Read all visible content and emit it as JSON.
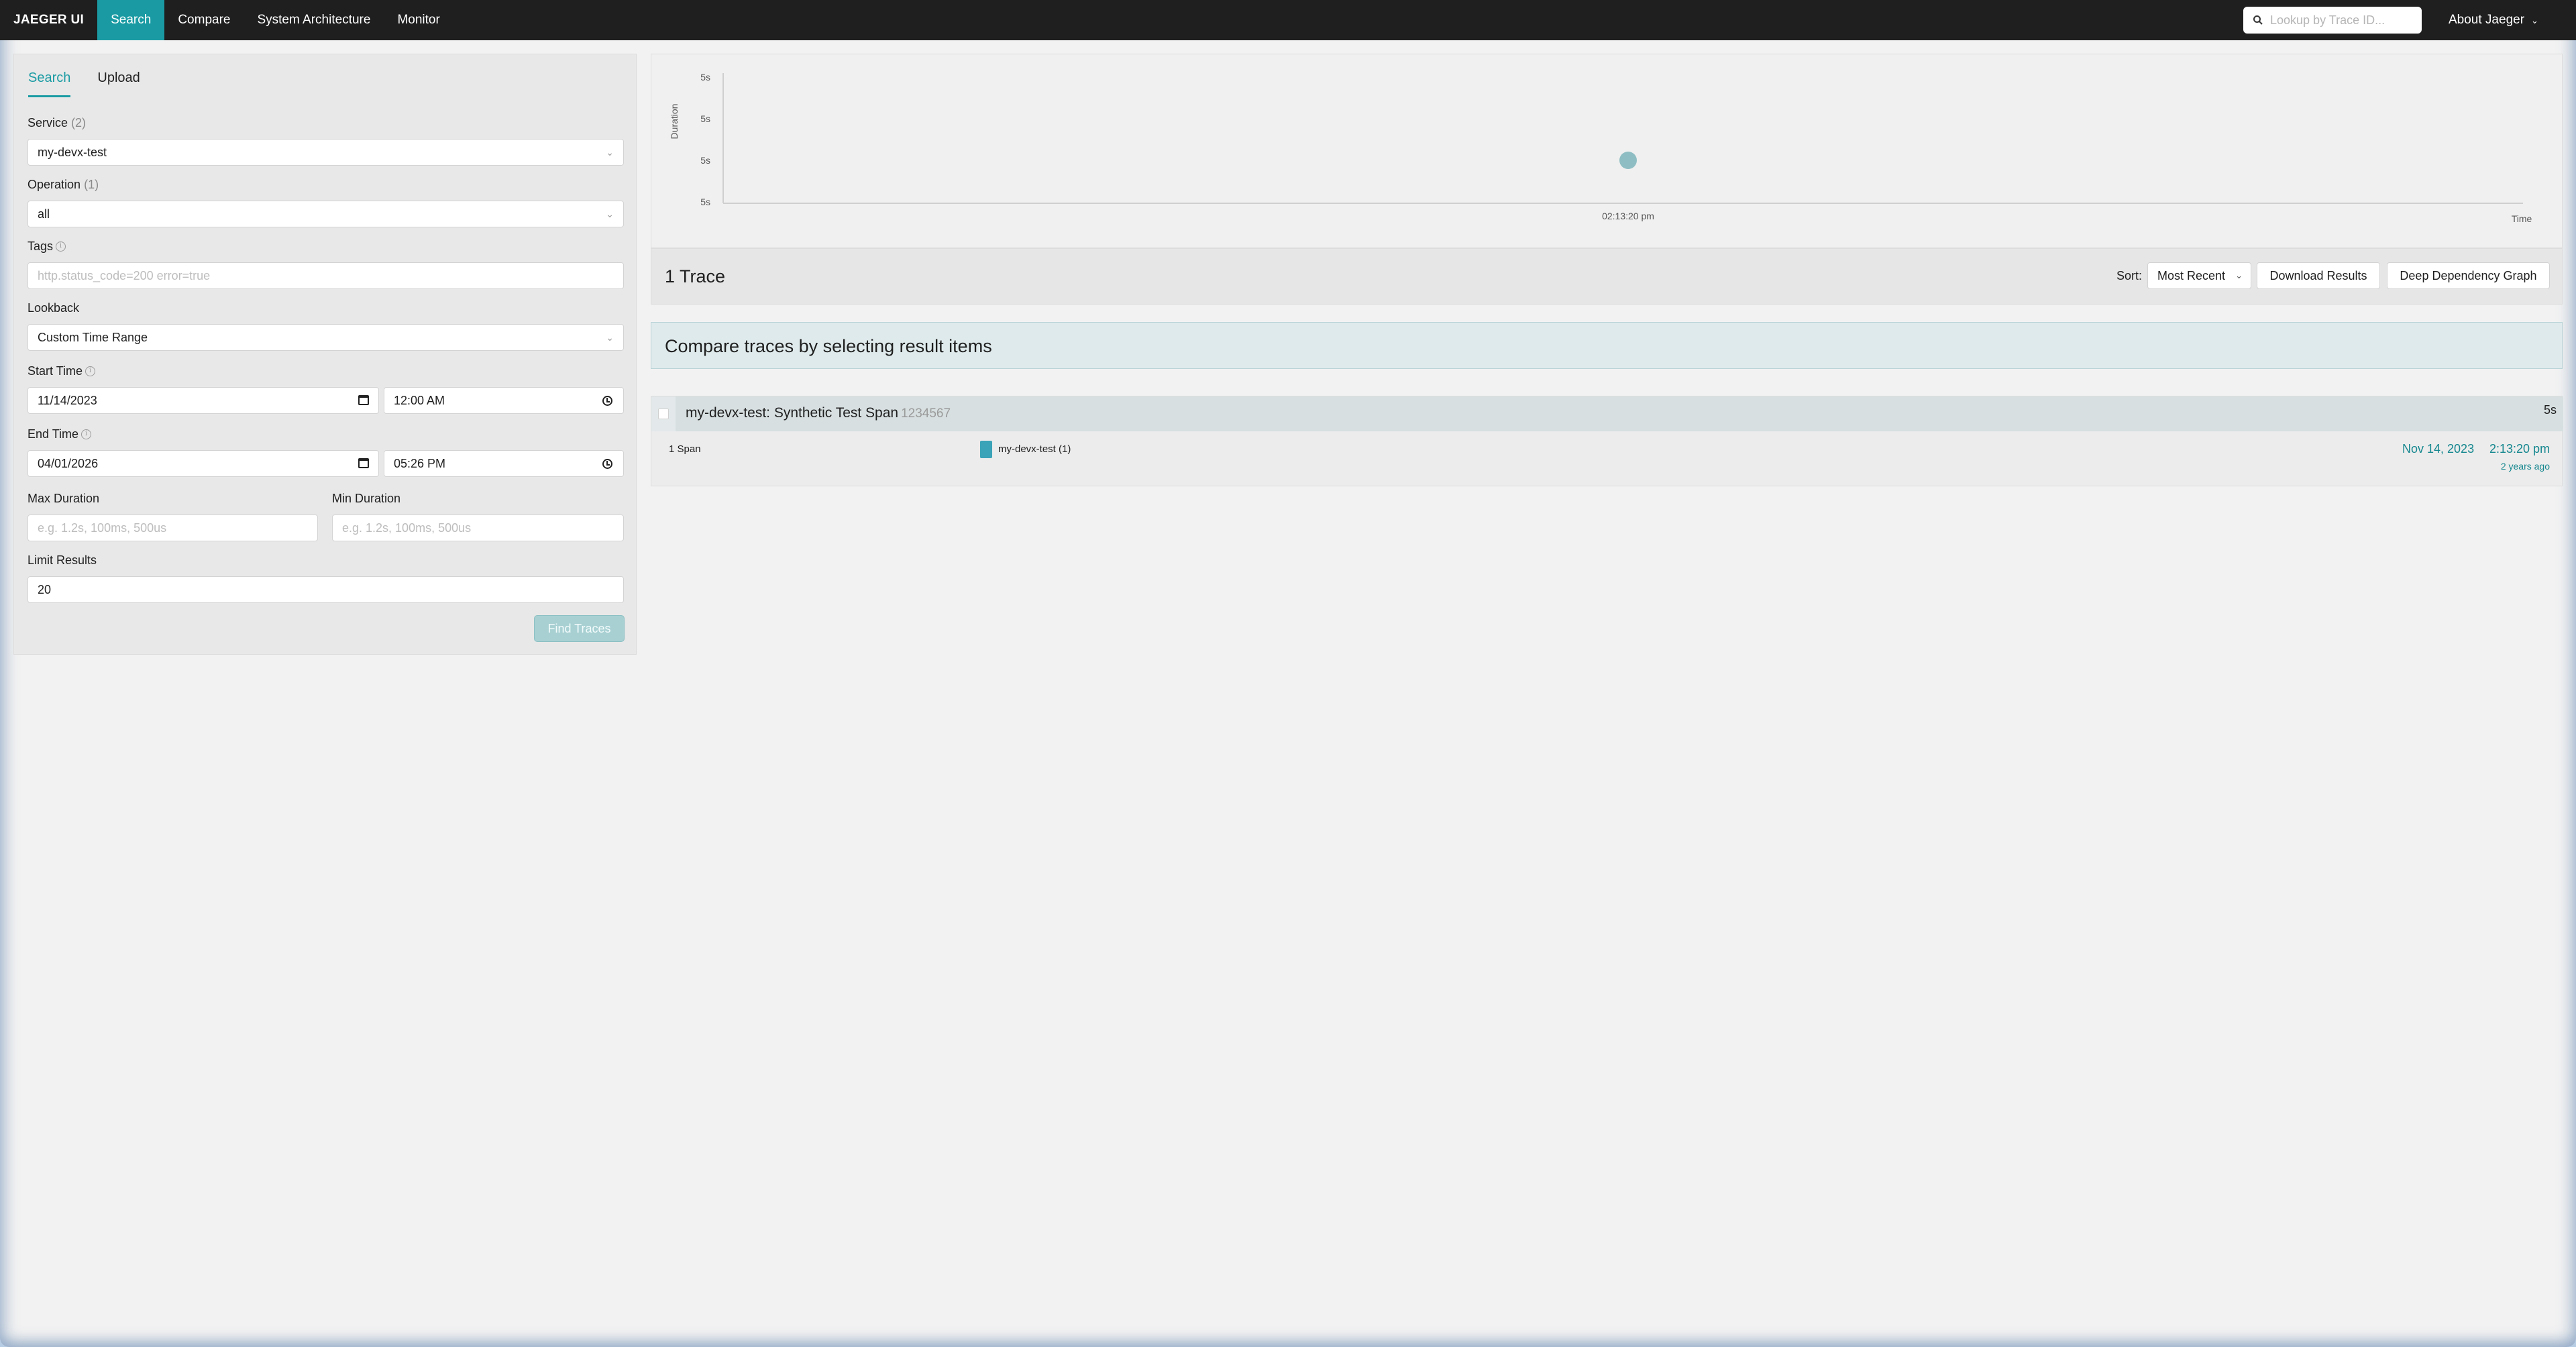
{
  "nav": {
    "brand": "JAEGER UI",
    "items": [
      {
        "label": "Search",
        "active": true
      },
      {
        "label": "Compare",
        "active": false
      },
      {
        "label": "System Architecture",
        "active": false
      },
      {
        "label": "Monitor",
        "active": false
      }
    ],
    "lookup_placeholder": "Lookup by Trace ID...",
    "about": "About Jaeger"
  },
  "form": {
    "tabs": [
      "Search",
      "Upload"
    ],
    "service": {
      "label": "Service",
      "count": "(2)",
      "value": "my-devx-test"
    },
    "operation": {
      "label": "Operation",
      "count": "(1)",
      "value": "all"
    },
    "tags": {
      "label": "Tags",
      "placeholder": "http.status_code=200 error=true"
    },
    "lookback": {
      "label": "Lookback",
      "value": "Custom Time Range"
    },
    "start_time": {
      "label": "Start Time",
      "date": "11/14/2023",
      "time": "12:00 AM"
    },
    "end_time": {
      "label": "End Time",
      "date": "04/01/2026",
      "time": "05:26 PM"
    },
    "max_duration": {
      "label": "Max Duration",
      "placeholder": "e.g. 1.2s, 100ms, 500us"
    },
    "min_duration": {
      "label": "Min Duration",
      "placeholder": "e.g. 1.2s, 100ms, 500us"
    },
    "limit": {
      "label": "Limit Results",
      "value": "20"
    },
    "find_button": "Find Traces"
  },
  "chart_data": {
    "type": "scatter",
    "ylabel": "Duration",
    "xlabel": "Time",
    "y_ticks": [
      "5s",
      "5s",
      "5s",
      "5s"
    ],
    "x_ticks": [
      "02:13:20 pm"
    ],
    "points": [
      {
        "x": "02:13:20 pm",
        "y": "5s"
      }
    ],
    "point_color": "#8ebec3"
  },
  "results": {
    "title": "1 Trace",
    "sort_label": "Sort:",
    "sort_value": "Most Recent",
    "download": "Download Results",
    "deep_dependency": "Deep Dependency Graph",
    "compare_hint": "Compare traces by selecting result items"
  },
  "trace": {
    "name": "my-devx-test: Synthetic Test Span",
    "id": "1234567",
    "duration": "5s",
    "spans": "1 Span",
    "service": "my-devx-test (1)",
    "service_color": "#3aa3b7",
    "date": "Nov 14, 2023",
    "time": "2:13:20 pm",
    "ago": "2 years ago"
  }
}
